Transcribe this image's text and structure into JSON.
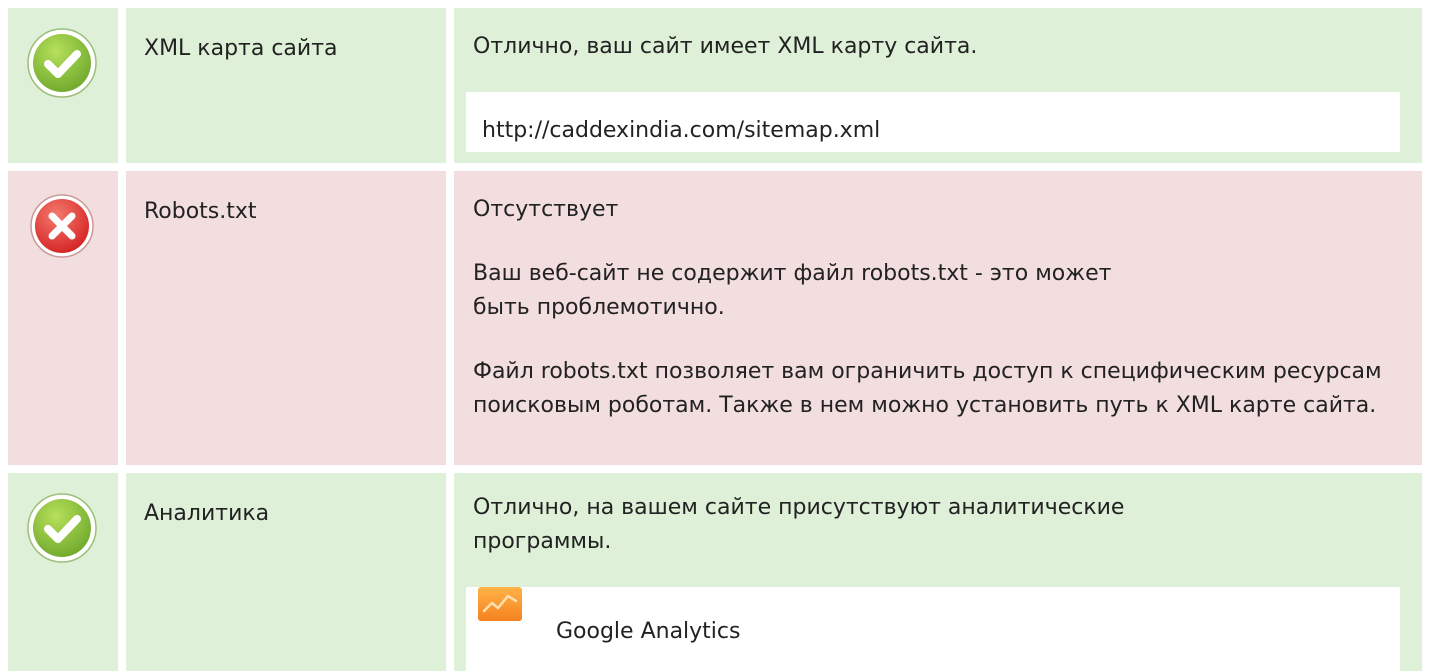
{
  "rows": [
    {
      "status": "pass",
      "label": "XML карта сайта",
      "message": "Отлично, ваш сайт имеет XML карту сайта.",
      "sitemap_url": "http://caddexindia.com/sitemap.xml"
    },
    {
      "status": "fail",
      "label": "Robots.txt",
      "message": "Отсутствует",
      "paragraph1": "Ваш веб-сайт не содержит файл robots.txt - это может быть проблемотично.",
      "paragraph2": "Файл robots.txt позволяет вам ограничить доступ к специфическим ресурсам поисковым роботам. Также в нем можно установить путь к XML карте сайта."
    },
    {
      "status": "pass",
      "label": "Аналитика",
      "message": "Отлично, на вашем сайте присутствуют аналитические программы.",
      "tool": {
        "name": "Google Analytics",
        "icon": "google-analytics-icon"
      }
    }
  ],
  "colors": {
    "pass_bg": "#dff0d8",
    "fail_bg": "#f2dede",
    "pass_icon": "#8cc63f",
    "fail_icon": "#e23a3a"
  }
}
